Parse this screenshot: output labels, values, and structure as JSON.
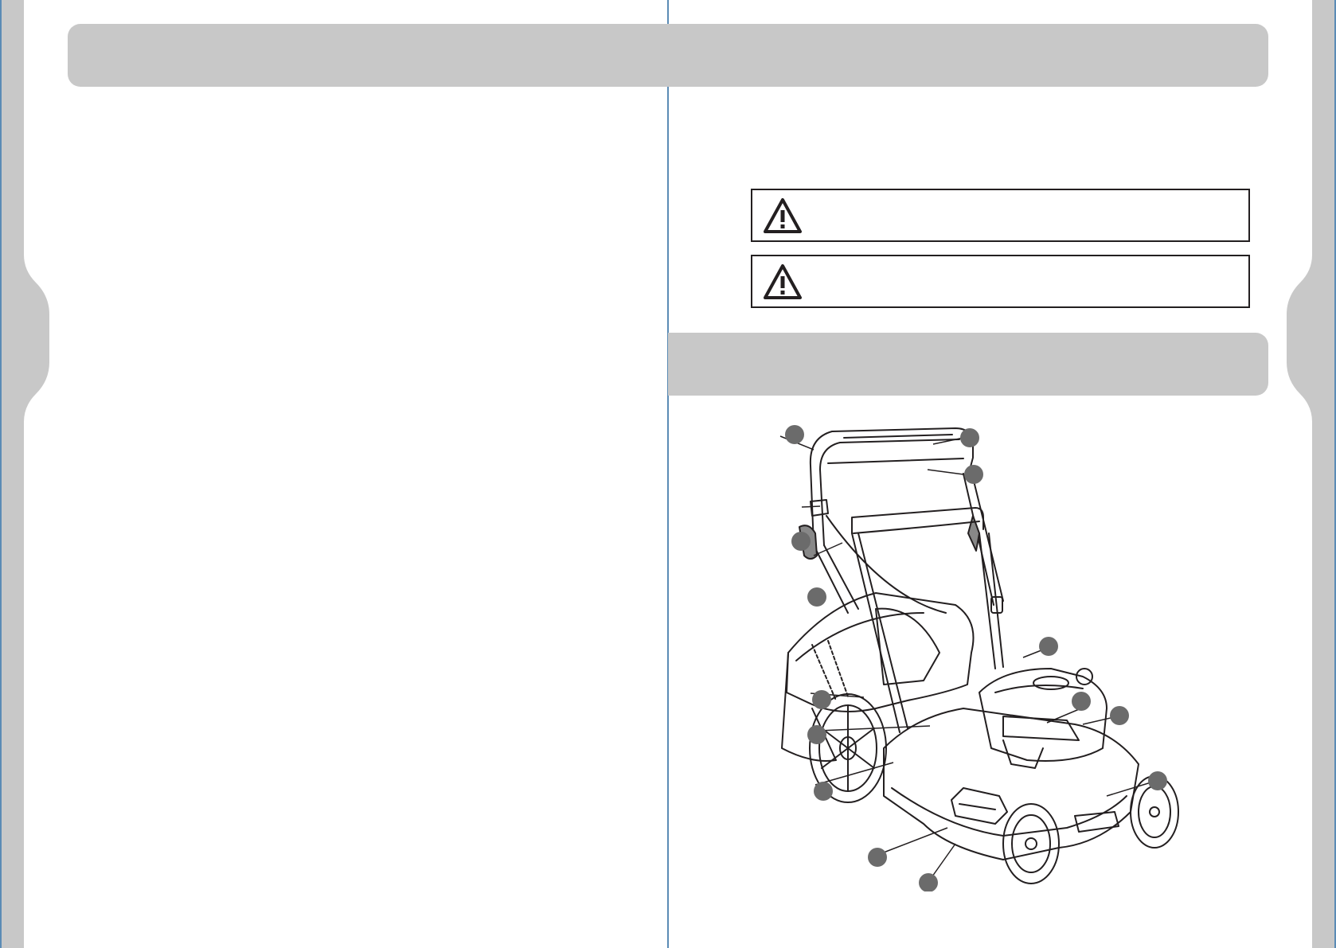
{
  "header": {
    "title": ""
  },
  "section": {
    "title": ""
  },
  "warnings": [
    {
      "icon": "warning-triangle-icon",
      "text": ""
    },
    {
      "icon": "warning-triangle-icon",
      "text": ""
    }
  ],
  "left_column": {
    "text": ""
  },
  "right_column": {
    "intro": ""
  },
  "figure": {
    "callouts": [
      "",
      "",
      "",
      "",
      "",
      "",
      "",
      "",
      "",
      "",
      "",
      "",
      "",
      "",
      ""
    ]
  },
  "colors": {
    "banner": "#c8c8c8",
    "side_tab": "#c8c8c8",
    "divider": "#5b8bb5",
    "ink": "#231f20",
    "callout": "#6b6b6b"
  }
}
